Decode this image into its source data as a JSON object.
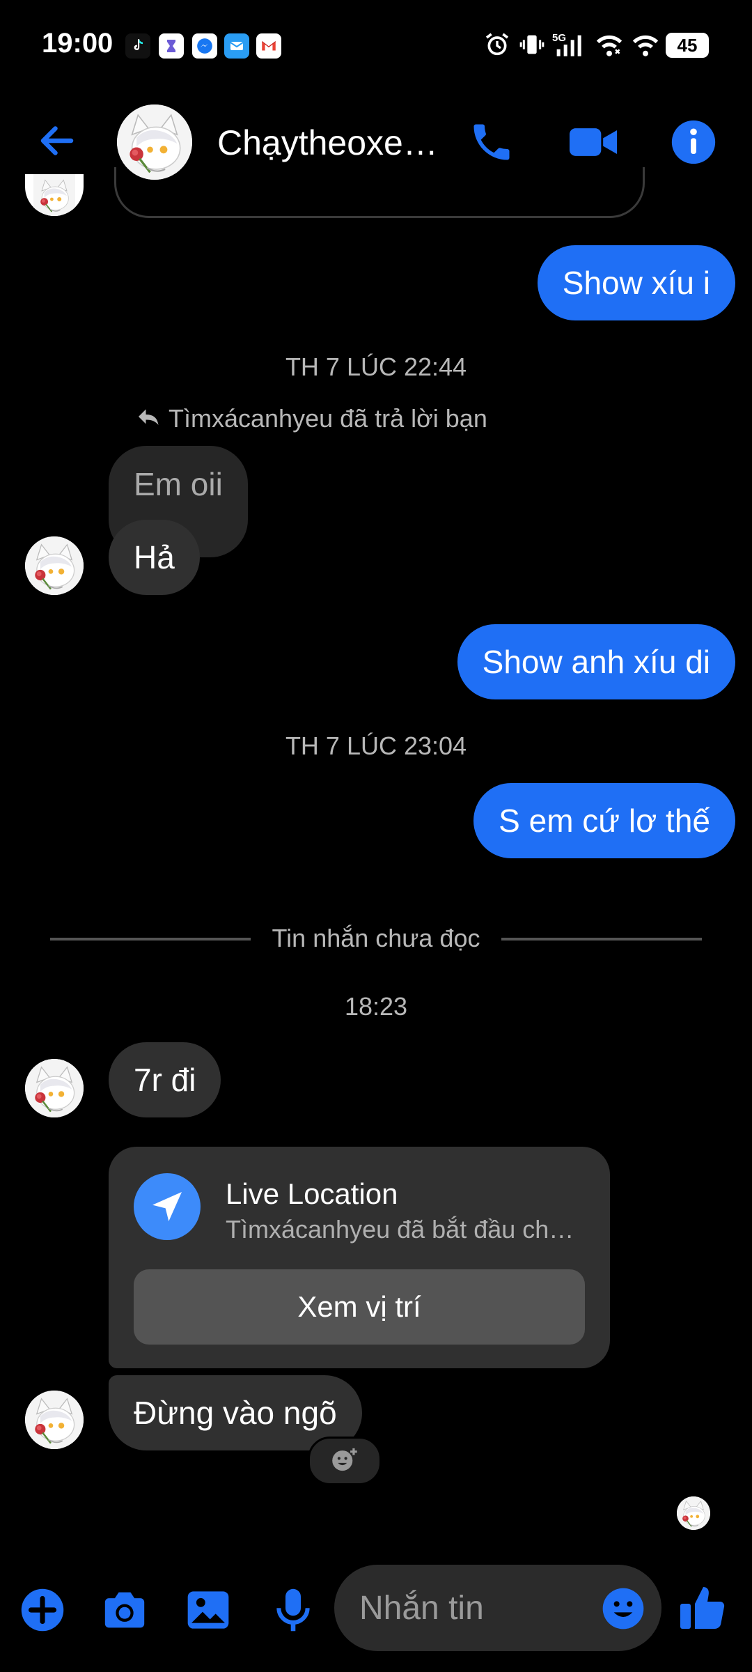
{
  "status_bar": {
    "time": "19:00",
    "battery": "45",
    "network": "5G",
    "notification_icons": [
      "tiktok-icon",
      "hourglass-icon",
      "messenger-icon",
      "mail-icon",
      "gmail-icon"
    ]
  },
  "header": {
    "title": "Chạytheoxe…",
    "actions": [
      "back-arrow-icon",
      "phone-icon",
      "video-camera-icon",
      "info-icon"
    ]
  },
  "conversation": {
    "messages": [
      {
        "id": "m1",
        "direction": "outgoing",
        "text": "Show xíu i"
      },
      {
        "id": "t1",
        "type": "timestamp",
        "text": "TH 7 LÚC 22:44"
      },
      {
        "id": "r1",
        "type": "reply_note",
        "text": "Tìmxácanhyeu đã trả lời bạn"
      },
      {
        "id": "m2",
        "direction": "incoming",
        "reply_preview": true,
        "text": "Em oii"
      },
      {
        "id": "m3",
        "direction": "incoming",
        "text": "Hả"
      },
      {
        "id": "m4",
        "direction": "outgoing",
        "text": "Show anh xíu di"
      },
      {
        "id": "t2",
        "type": "timestamp",
        "text": "TH 7 LÚC 23:04"
      },
      {
        "id": "m5",
        "direction": "outgoing",
        "text": "S em cứ lơ thế"
      },
      {
        "id": "d1",
        "type": "divider",
        "text": "Tin nhắn chưa đọc"
      },
      {
        "id": "t3",
        "type": "timestamp",
        "text": "18:23"
      },
      {
        "id": "m6",
        "direction": "incoming",
        "text": "7r đi"
      },
      {
        "id": "m7",
        "direction": "incoming",
        "type": "live_location",
        "title": "Live Location",
        "subtitle": "Tìmxácanhyeu đã bắt đầu ch…",
        "button": "Xem vị trí"
      },
      {
        "id": "m8",
        "direction": "incoming",
        "text": "Đừng vào ngõ"
      }
    ]
  },
  "composer": {
    "placeholder": "Nhắn tin",
    "tools": [
      "plus-icon",
      "camera-icon",
      "image-icon",
      "microphone-icon"
    ],
    "emoji": "emoji-icon",
    "send": "thumbs-up-icon"
  },
  "colors": {
    "accent": "#1F6FF5",
    "incoming_bubble": "#303030",
    "background": "#000000",
    "location_icon": "#3D8BFA"
  }
}
